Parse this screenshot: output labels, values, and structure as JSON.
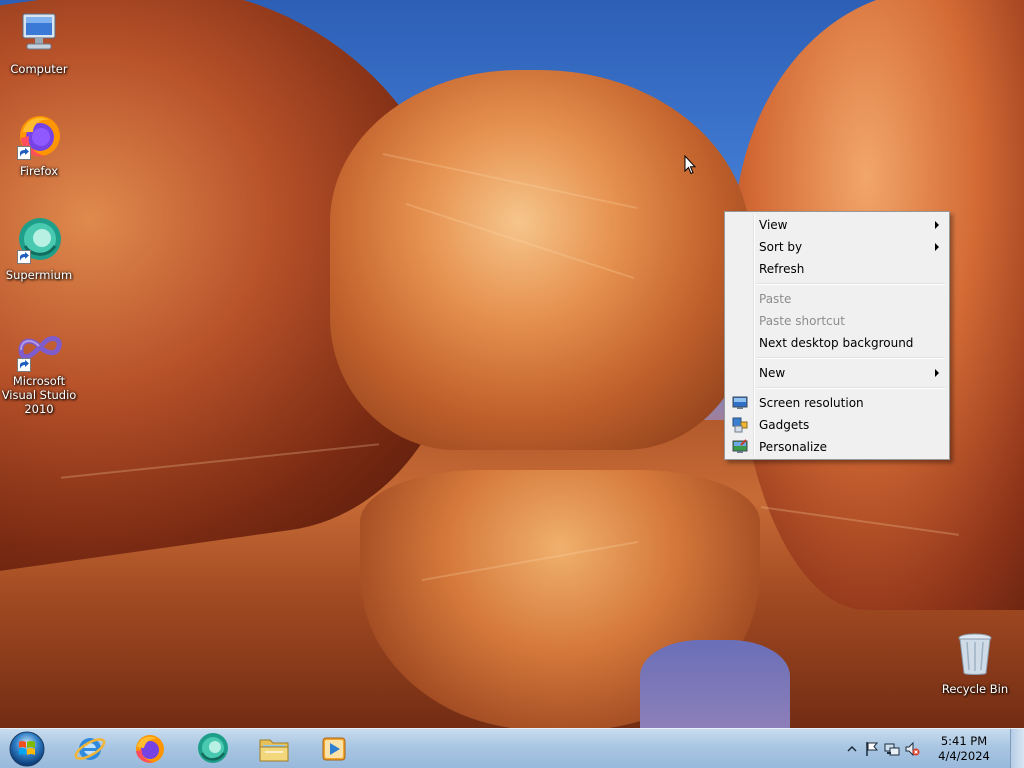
{
  "desktop": {
    "icons": [
      {
        "label": "Computer",
        "icon": "computer-icon"
      },
      {
        "label": "Firefox",
        "icon": "firefox-icon"
      },
      {
        "label": "Supermium",
        "icon": "supermium-icon"
      },
      {
        "label": "Microsoft Visual Studio 2010",
        "icon": "visual-studio-icon"
      },
      {
        "label": "Recycle Bin",
        "icon": "recycle-bin-icon"
      }
    ]
  },
  "context_menu": {
    "items": [
      {
        "label": "View",
        "submenu": true,
        "enabled": true
      },
      {
        "label": "Sort by",
        "submenu": true,
        "enabled": true
      },
      {
        "label": "Refresh",
        "submenu": false,
        "enabled": true
      },
      {
        "label": "Paste",
        "submenu": false,
        "enabled": false
      },
      {
        "label": "Paste shortcut",
        "submenu": false,
        "enabled": false
      },
      {
        "label": "Next desktop background",
        "submenu": false,
        "enabled": true
      },
      {
        "label": "New",
        "submenu": true,
        "enabled": true
      },
      {
        "label": "Screen resolution",
        "icon": "screen-resolution-icon",
        "enabled": true
      },
      {
        "label": "Gadgets",
        "icon": "gadgets-icon",
        "enabled": true
      },
      {
        "label": "Personalize",
        "icon": "personalize-icon",
        "enabled": true
      }
    ]
  },
  "taskbar": {
    "apps": [
      {
        "name": "Internet Explorer",
        "icon": "internet-explorer-icon"
      },
      {
        "name": "Firefox",
        "icon": "firefox-icon"
      },
      {
        "name": "Supermium",
        "icon": "supermium-icon"
      },
      {
        "name": "Windows Explorer",
        "icon": "folder-icon"
      },
      {
        "name": "Windows Media Player",
        "icon": "media-player-icon"
      }
    ],
    "tray": {
      "time": "5:41 PM",
      "date": "4/4/2024",
      "icons": [
        "show-hidden-icons-icon",
        "action-center-flag-icon",
        "network-icon",
        "volume-muted-icon"
      ]
    }
  },
  "colors": {
    "menu_bg": "#f0f0f0",
    "menu_border": "#979797",
    "disabled_text": "#8d8d8d",
    "taskbar_top": "#c8dcef",
    "taskbar_bottom": "#98b9db"
  }
}
